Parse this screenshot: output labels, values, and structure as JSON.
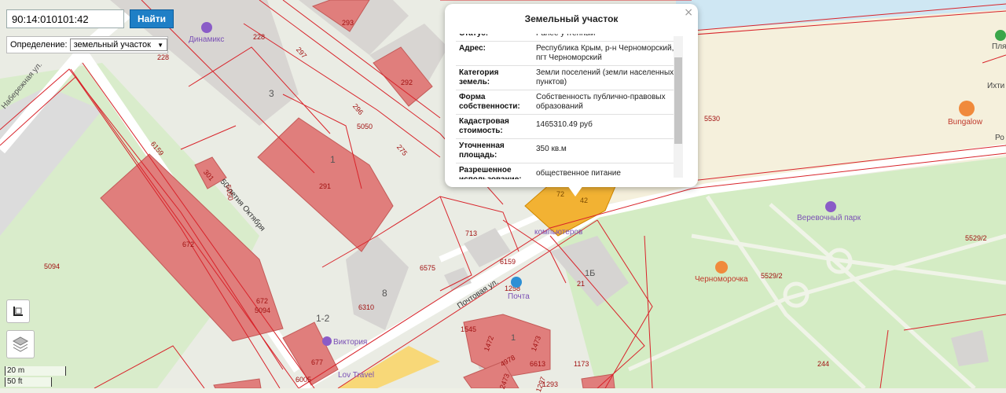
{
  "search": {
    "value": "90:14:010101:42",
    "button": "Найти"
  },
  "definition": {
    "label": "Определение:",
    "selected": "земельный участок"
  },
  "scale": {
    "metric": "20 m",
    "imperial": "50 ft"
  },
  "popup": {
    "title": "Земельный участок",
    "close": "×",
    "rows": [
      {
        "key": "Статус:",
        "value": "Ранее учтенный"
      },
      {
        "key": "Адрес:",
        "value": "Республика Крым, р-н Черноморский, пгт Черноморский"
      },
      {
        "key": "Категория земель:",
        "value": "Земли поселений (земли населенных пунктов)"
      },
      {
        "key": "Форма собственности:",
        "value": "Собственность публично-правовых образований"
      },
      {
        "key": "Кадастровая стоимость:",
        "value": "1465310.49 руб"
      },
      {
        "key": "Уточненная площадь:",
        "value": "350 кв.м"
      },
      {
        "key": "Разрешенное использование:",
        "value": "общественное питание"
      }
    ]
  },
  "map": {
    "streets": {
      "naberezhnaya": "Набережная ул.",
      "oktyabrya": "50-летия Октября",
      "pochtovaya": "Почтовая ул."
    },
    "pois": {
      "dinamiks": "Динамикс",
      "viktoriya": "Виктория",
      "travel": "Lov Travel",
      "verevochny": "Веревочный парк",
      "chernomorochka": "Черноморочка",
      "bungalow": "Bungalow",
      "kompyuterov": "компьютеров",
      "pochta": "Почта",
      "plya": "Пля",
      "ikhti": "Ихти",
      "ro": "Ро"
    },
    "parcels": [
      "228",
      "228",
      "293",
      "297",
      "292",
      "296",
      "5050",
      "275",
      "301",
      "5050",
      "291",
      "6159",
      "672",
      "672",
      "5094",
      "5094",
      "713",
      "6575",
      "6159",
      "6310",
      "1258",
      "1545",
      "1472",
      "1473",
      "1297",
      "4978",
      "6613",
      "1173",
      "2473",
      "1293",
      "677",
      "6005",
      "5530",
      "5529/2",
      "5529/2",
      "244",
      "21",
      "72",
      "42"
    ],
    "buildings": [
      "3",
      "1",
      "8",
      "1-2",
      "1Б",
      "1"
    ]
  },
  "colors": {
    "building_cadastre": "#e07e7c",
    "parcel_line": "#d8232a",
    "selected_parcel": "#f2b233",
    "water": "#cfe7f3",
    "sand": "#f5f0dc",
    "green": "#d4ecc4"
  }
}
